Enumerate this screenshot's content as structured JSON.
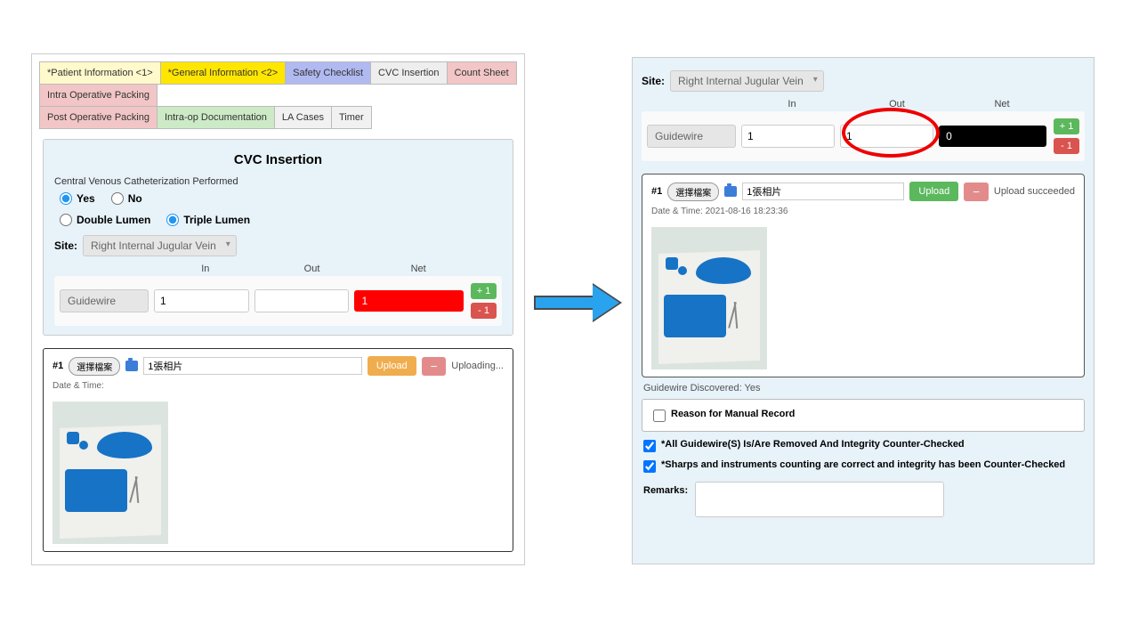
{
  "tabs": {
    "patient": "*Patient Information <1>",
    "general": "*General Information <2>",
    "safety": "Safety Checklist",
    "cvc": "CVC Insertion",
    "count": "Count Sheet",
    "intra_pack": "Intra Operative Packing",
    "post_pack": "Post Operative Packing",
    "intra_doc": "Intra-op Documentation",
    "la": "LA Cases",
    "timer": "Timer"
  },
  "cvc": {
    "title": "CVC Insertion",
    "question": "Central Venous Catheterization Performed",
    "yes": "Yes",
    "no": "No",
    "double": "Double Lumen",
    "triple": "Triple Lumen",
    "site_label": "Site:",
    "site_value": "Right Internal Jugular Vein",
    "headers": {
      "in": "In",
      "out": "Out",
      "net": "Net"
    },
    "row_label": "Guidewire",
    "plus": "+ 1",
    "minus": "- 1"
  },
  "left_state": {
    "in": "1",
    "out": "",
    "net": "1",
    "upload_num": "#1",
    "filebtn": "選擇檔案",
    "ph_placeholder": "1張相片",
    "upload": "Upload",
    "del": "−",
    "status": "Uploading...",
    "dt_label": "Date & Time:"
  },
  "right_state": {
    "in": "1",
    "out": "1",
    "net": "0",
    "upload_num": "#1",
    "filebtn": "選擇檔案",
    "ph_placeholder": "1張相片",
    "upload": "Upload",
    "del": "−",
    "status": "Upload succeeded",
    "dt_label": "Date & Time: 2021-08-16 18:23:36",
    "gd": "Guidewire Discovered: Yes",
    "reason": "Reason for Manual Record",
    "ck1": "*All Guidewire(S) Is/Are Removed And Integrity Counter-Checked",
    "ck2": "*Sharps and instruments counting are correct and integrity has been Counter-Checked",
    "remarks_label": "Remarks:"
  }
}
